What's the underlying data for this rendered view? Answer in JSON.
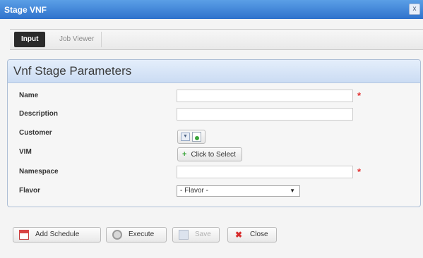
{
  "window": {
    "title": "Stage VNF",
    "close_glyph": "x"
  },
  "tabs": [
    {
      "label": "Input",
      "active": true
    },
    {
      "label": "Job Viewer",
      "active": false
    }
  ],
  "panel": {
    "title": "Vnf Stage Parameters",
    "fields": {
      "name": {
        "label": "Name",
        "value": "",
        "required": true
      },
      "description": {
        "label": "Description",
        "value": ""
      },
      "customer": {
        "label": "Customer"
      },
      "vim": {
        "label": "VIM",
        "button_label": "Click to Select"
      },
      "namespace": {
        "label": "Namespace",
        "value": "",
        "required": true
      },
      "flavor": {
        "label": "Flavor",
        "selected": "- Flavor -"
      }
    },
    "required_marker": "*"
  },
  "footer": {
    "add_schedule": "Add Schedule",
    "execute": "Execute",
    "save": "Save",
    "close": "Close"
  },
  "colors": {
    "titlebar": "#2f72cc",
    "panel_header": "#cbdcf3",
    "required": "#e23030",
    "close_x": "#d72c2c"
  },
  "icons": {
    "add_schedule": "calendar-icon",
    "execute": "gear-icon",
    "save": "floppy-disk-icon",
    "close": "close-x-icon",
    "vim_add": "plus-icon",
    "customer": "customer-lookup-icon"
  }
}
